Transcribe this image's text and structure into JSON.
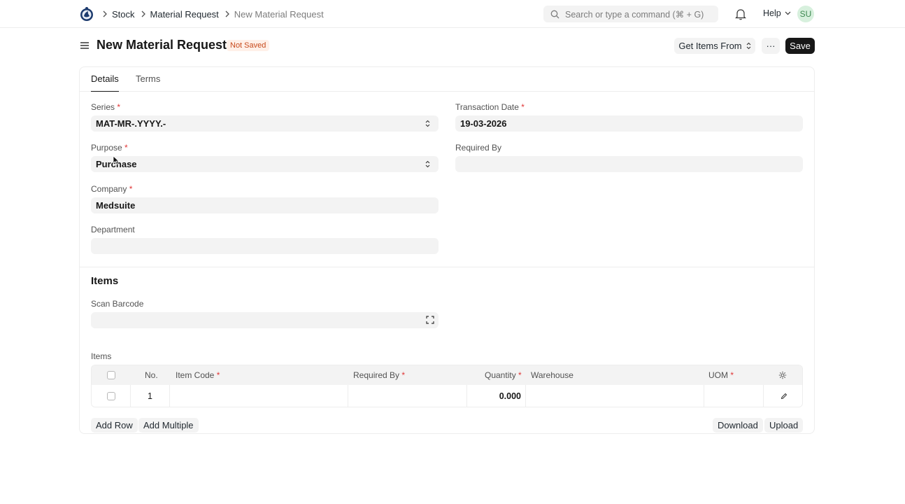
{
  "navbar": {
    "breadcrumbs": [
      "Stock",
      "Material Request",
      "New Material Request"
    ],
    "search_placeholder": "Search or type a command (⌘ + G)",
    "help_label": "Help",
    "avatar_initials": "SU"
  },
  "page": {
    "title": "New Material Request",
    "status": "Not Saved",
    "get_items_label": "Get Items From",
    "more_label": "···",
    "save_label": "Save"
  },
  "tabs": [
    "Details",
    "Terms"
  ],
  "form": {
    "series_label": "Series",
    "series_value": "MAT-MR-.YYYY.-",
    "transaction_date_label": "Transaction Date",
    "transaction_date_value": "19-03-2026",
    "purpose_label": "Purpose",
    "purpose_value": "Purchase",
    "required_by_label": "Required By",
    "required_by_value": "",
    "company_label": "Company",
    "company_value": "Medsuite",
    "department_label": "Department",
    "department_value": ""
  },
  "items_section": {
    "title": "Items",
    "scan_barcode_label": "Scan Barcode",
    "table_label": "Items",
    "columns": [
      "No.",
      "Item Code",
      "Required By",
      "Quantity",
      "Warehouse",
      "UOM"
    ],
    "rows": [
      {
        "no": "1",
        "item_code": "",
        "required_by": "",
        "quantity": "0.000",
        "warehouse": "",
        "uom": ""
      }
    ],
    "add_row_label": "Add Row",
    "add_multiple_label": "Add Multiple",
    "download_label": "Download",
    "upload_label": "Upload"
  },
  "colors": {
    "primary_button": "#171717",
    "badge_bg": "#fff0e8",
    "badge_text": "#c74a1c",
    "required_mark": "#e03636"
  }
}
